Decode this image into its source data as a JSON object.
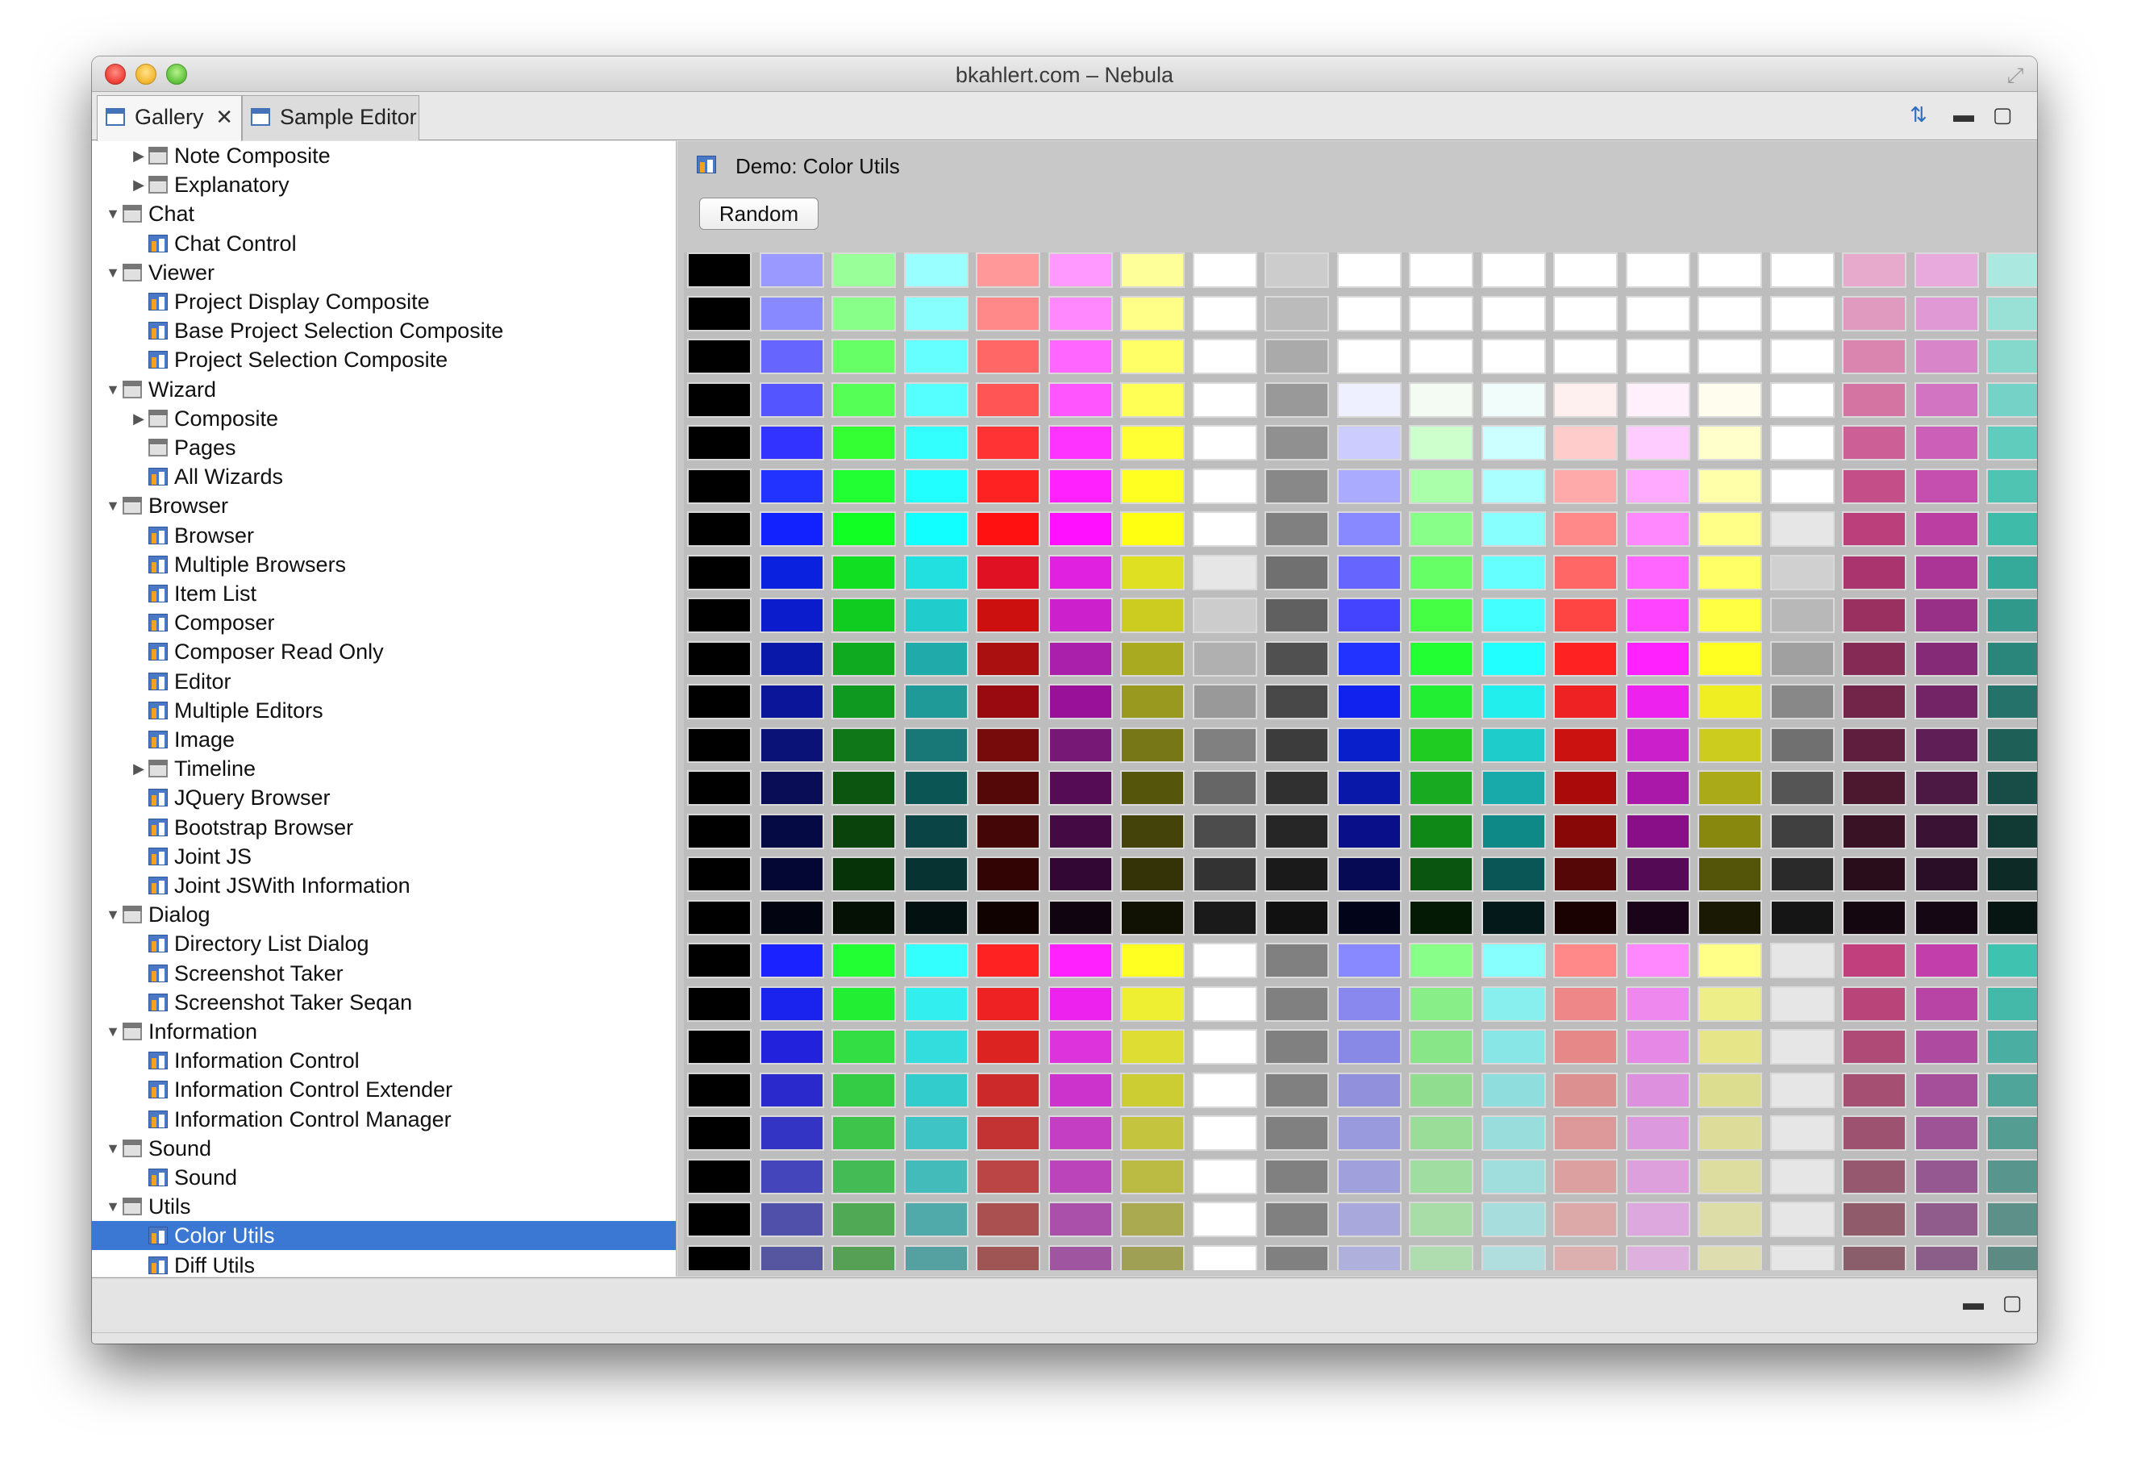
{
  "window": {
    "title": "bkahlert.com – Nebula"
  },
  "tabs": [
    {
      "label": "Gallery",
      "icon": "view-icon",
      "active": true,
      "closable": true
    },
    {
      "label": "Sample Editor",
      "icon": "view-icon",
      "active": false,
      "closable": false
    }
  ],
  "toolbar": {
    "sync_icon": "sync-icon",
    "minimize_icon": "minimize-icon",
    "maximize_icon": "maximize-icon"
  },
  "tree": [
    {
      "label": "Note Composite",
      "depth": 1,
      "twisty": "collapsed",
      "icon": "folder"
    },
    {
      "label": "Explanatory",
      "depth": 1,
      "twisty": "collapsed",
      "icon": "folder"
    },
    {
      "label": "Chat",
      "depth": 0,
      "twisty": "expanded",
      "icon": "folder"
    },
    {
      "label": "Chat Control",
      "depth": 1,
      "twisty": "none",
      "icon": "demo"
    },
    {
      "label": "Viewer",
      "depth": 0,
      "twisty": "expanded",
      "icon": "folder"
    },
    {
      "label": "Project Display Composite",
      "depth": 1,
      "twisty": "none",
      "icon": "demo"
    },
    {
      "label": "Base Project Selection Composite",
      "depth": 1,
      "twisty": "none",
      "icon": "demo"
    },
    {
      "label": "Project Selection Composite",
      "depth": 1,
      "twisty": "none",
      "icon": "demo"
    },
    {
      "label": "Wizard",
      "depth": 0,
      "twisty": "expanded",
      "icon": "folder"
    },
    {
      "label": "Composite",
      "depth": 1,
      "twisty": "collapsed",
      "icon": "folder"
    },
    {
      "label": "Pages",
      "depth": 1,
      "twisty": "none",
      "icon": "folder"
    },
    {
      "label": "All Wizards",
      "depth": 1,
      "twisty": "none",
      "icon": "demo"
    },
    {
      "label": "Browser",
      "depth": 0,
      "twisty": "expanded",
      "icon": "folder"
    },
    {
      "label": "Browser",
      "depth": 1,
      "twisty": "none",
      "icon": "demo"
    },
    {
      "label": "Multiple Browsers",
      "depth": 1,
      "twisty": "none",
      "icon": "demo"
    },
    {
      "label": "Item List",
      "depth": 1,
      "twisty": "none",
      "icon": "demo"
    },
    {
      "label": "Composer",
      "depth": 1,
      "twisty": "none",
      "icon": "demo"
    },
    {
      "label": "Composer Read Only",
      "depth": 1,
      "twisty": "none",
      "icon": "demo"
    },
    {
      "label": "Editor",
      "depth": 1,
      "twisty": "none",
      "icon": "demo"
    },
    {
      "label": "Multiple Editors",
      "depth": 1,
      "twisty": "none",
      "icon": "demo"
    },
    {
      "label": "Image",
      "depth": 1,
      "twisty": "none",
      "icon": "demo"
    },
    {
      "label": "Timeline",
      "depth": 1,
      "twisty": "collapsed",
      "icon": "folder"
    },
    {
      "label": "JQuery Browser",
      "depth": 1,
      "twisty": "none",
      "icon": "demo"
    },
    {
      "label": "Bootstrap Browser",
      "depth": 1,
      "twisty": "none",
      "icon": "demo"
    },
    {
      "label": "Joint JS",
      "depth": 1,
      "twisty": "none",
      "icon": "demo"
    },
    {
      "label": "Joint JSWith Information",
      "depth": 1,
      "twisty": "none",
      "icon": "demo"
    },
    {
      "label": "Dialog",
      "depth": 0,
      "twisty": "expanded",
      "icon": "folder"
    },
    {
      "label": "Directory List Dialog",
      "depth": 1,
      "twisty": "none",
      "icon": "demo"
    },
    {
      "label": "Screenshot Taker",
      "depth": 1,
      "twisty": "none",
      "icon": "demo"
    },
    {
      "label": "Screenshot Taker Seqan",
      "depth": 1,
      "twisty": "none",
      "icon": "demo"
    },
    {
      "label": "Information",
      "depth": 0,
      "twisty": "expanded",
      "icon": "folder"
    },
    {
      "label": "Information Control",
      "depth": 1,
      "twisty": "none",
      "icon": "demo"
    },
    {
      "label": "Information Control Extender",
      "depth": 1,
      "twisty": "none",
      "icon": "demo"
    },
    {
      "label": "Information Control Manager",
      "depth": 1,
      "twisty": "none",
      "icon": "demo"
    },
    {
      "label": "Sound",
      "depth": 0,
      "twisty": "expanded",
      "icon": "folder"
    },
    {
      "label": "Sound",
      "depth": 1,
      "twisty": "none",
      "icon": "demo"
    },
    {
      "label": "Utils",
      "depth": 0,
      "twisty": "expanded",
      "icon": "folder"
    },
    {
      "label": "Color Utils",
      "depth": 1,
      "twisty": "none",
      "icon": "demo",
      "selected": true
    },
    {
      "label": "Diff Utils",
      "depth": 1,
      "twisty": "none",
      "icon": "demo"
    }
  ],
  "demo": {
    "title": "Demo: Color Utils",
    "random_label": "Random"
  },
  "palette": {
    "rows_opaque": [
      [
        "#000000",
        "#9999ff",
        "#99ff99",
        "#99ffff",
        "#ff9999",
        "#ff99ff",
        "#ffff99",
        "#ffffff",
        "#cccccc",
        "#ffffff",
        "#ffffff",
        "#ffffff",
        "#ffffff",
        "#ffffff",
        "#ffffff",
        "#ffffff",
        "#e8aacc",
        "#e8aadd",
        "#aae8e0"
      ],
      [
        "#000000",
        "#8888ff",
        "#88ff88",
        "#88ffff",
        "#ff8888",
        "#ff88ff",
        "#ffff88",
        "#ffffff",
        "#bbbbbb",
        "#ffffff",
        "#ffffff",
        "#ffffff",
        "#ffffff",
        "#ffffff",
        "#ffffff",
        "#ffffff",
        "#e099bf",
        "#e099d4",
        "#99e0d6"
      ],
      [
        "#000000",
        "#6666ff",
        "#66ff66",
        "#66ffff",
        "#ff6666",
        "#ff66ff",
        "#ffff66",
        "#ffffff",
        "#aaaaaa",
        "#ffffff",
        "#ffffff",
        "#ffffff",
        "#ffffff",
        "#ffffff",
        "#ffffff",
        "#ffffff",
        "#d985b0",
        "#d985c9",
        "#85d9cc"
      ],
      [
        "#000000",
        "#5555ff",
        "#55ff55",
        "#55ffff",
        "#ff5555",
        "#ff55ff",
        "#ffff55",
        "#ffffff",
        "#999999",
        "#eef0ff",
        "#f3fbf3",
        "#f0fdfb",
        "#fff0f0",
        "#fff0fb",
        "#fffdee",
        "#ffffff",
        "#d374a3",
        "#d374c2",
        "#74d3c6"
      ],
      [
        "#000000",
        "#3333ff",
        "#33ff33",
        "#33ffff",
        "#ff3333",
        "#ff33ff",
        "#ffff33",
        "#ffffff",
        "#909090",
        "#ccccff",
        "#ccffcc",
        "#ccffff",
        "#ffcccc",
        "#ffccff",
        "#ffffcc",
        "#ffffff",
        "#cc5f96",
        "#cc5fb8",
        "#5fccbd"
      ],
      [
        "#000000",
        "#2233ff",
        "#22ff33",
        "#22ffff",
        "#ff2222",
        "#ff22ff",
        "#ffff22",
        "#ffffff",
        "#888888",
        "#aaaaff",
        "#aaffaa",
        "#aaffff",
        "#ffaaaa",
        "#ffaaff",
        "#ffffaa",
        "#ffffff",
        "#c44f88",
        "#c44fae",
        "#4fc4b3"
      ],
      [
        "#000000",
        "#1122ff",
        "#11ff22",
        "#11ffff",
        "#ff1111",
        "#ff11ff",
        "#ffff11",
        "#ffffff",
        "#808080",
        "#8888ff",
        "#88ff88",
        "#88ffff",
        "#ff8888",
        "#ff88ff",
        "#ffff88",
        "#e6e6e6",
        "#bb3f7b",
        "#bb3fa3",
        "#3fbba9"
      ],
      [
        "#000000",
        "#0a22e0",
        "#11e022",
        "#22e0e0",
        "#e01122",
        "#e022e0",
        "#e0e022",
        "#e6e6e6",
        "#707070",
        "#6666ff",
        "#66ff66",
        "#66ffff",
        "#ff6666",
        "#ff66ff",
        "#ffff66",
        "#d0d0d0",
        "#aa356e",
        "#aa3596",
        "#35aa9b"
      ],
      [
        "#000000",
        "#0a1ccc",
        "#10cc20",
        "#20cccc",
        "#cc1010",
        "#cc20cc",
        "#cccc20",
        "#cccccc",
        "#606060",
        "#4444ff",
        "#44ff44",
        "#44ffff",
        "#ff4444",
        "#ff44ff",
        "#ffff44",
        "#b8b8b8",
        "#993060",
        "#993088",
        "#30998c"
      ],
      [
        "#000000",
        "#0a18aa",
        "#10aa20",
        "#20aaaa",
        "#aa1010",
        "#aa20aa",
        "#aaaa20",
        "#b0b0b0",
        "#505050",
        "#2233ff",
        "#22ff33",
        "#22ffff",
        "#ff2222",
        "#ff22ff",
        "#ffff22",
        "#a0a0a0",
        "#852a54",
        "#852a77",
        "#2a857a"
      ],
      [
        "#000000",
        "#0a1599",
        "#109920",
        "#209999",
        "#990a10",
        "#991099",
        "#999920",
        "#999999",
        "#484848",
        "#1122ee",
        "#22ee33",
        "#22eeee",
        "#ee2222",
        "#ee22ee",
        "#eeee22",
        "#888888",
        "#722449",
        "#722466",
        "#247269"
      ],
      [
        "#000000",
        "#0a1177",
        "#107718",
        "#187777",
        "#770a0a",
        "#771877",
        "#777718",
        "#808080",
        "#3c3c3c",
        "#0a1fcc",
        "#1fcc22",
        "#1fcccc",
        "#cc1111",
        "#cc1fcc",
        "#cccc1f",
        "#707070",
        "#5f1e3d",
        "#5f1e55",
        "#1e5f57"
      ],
      [
        "#000000",
        "#080d55",
        "#0c5510",
        "#0c5555",
        "#550808",
        "#550c55",
        "#55550c",
        "#666666",
        "#303030",
        "#0a18aa",
        "#18aa20",
        "#18aaaa",
        "#aa0a0a",
        "#aa18aa",
        "#aaaa18",
        "#555555",
        "#4c1830",
        "#4c1844",
        "#184c46"
      ],
      [
        "#000000",
        "#060a44",
        "#0a440c",
        "#0a4444",
        "#440606",
        "#440a44",
        "#44440a",
        "#4c4c4c",
        "#262626",
        "#080f88",
        "#0f8818",
        "#0f8888",
        "#880808",
        "#880f88",
        "#88880f",
        "#404040",
        "#3a1225",
        "#3a1234",
        "#123a35"
      ],
      [
        "#000000",
        "#040733",
        "#073308",
        "#073333",
        "#330404",
        "#330733",
        "#333307",
        "#333333",
        "#1a1a1a",
        "#060a55",
        "#0a5510",
        "#0a5555",
        "#550606",
        "#550a55",
        "#55550a",
        "#2a2a2a",
        "#2a0d1b",
        "#2a0d26",
        "#0d2a27"
      ],
      [
        "#000000",
        "#020411",
        "#041104",
        "#041111",
        "#110202",
        "#110411",
        "#111104",
        "#1a1a1a",
        "#111111",
        "#02041a",
        "#041a04",
        "#041a1a",
        "#1a0202",
        "#1a041a",
        "#1a1a04",
        "#151515",
        "#150710",
        "#150713",
        "#071513"
      ],
      [
        "#000000",
        "#1a22ff",
        "#22ff33",
        "#33ffff",
        "#ff2222",
        "#ff22ff",
        "#ffff22",
        "#ffffff",
        "#808080",
        "#8888ff",
        "#88ff88",
        "#88ffff",
        "#ff8888",
        "#ff88ff",
        "#ffff88",
        "#e6e6e6",
        "#c23f7e",
        "#c23fab",
        "#3fc2b0"
      ],
      [
        "#000000",
        "#1a22ee",
        "#22ee33",
        "#33eeee",
        "#ee2222",
        "#ee22ee",
        "#eeee33",
        "#ffffff",
        "#808080",
        "#8888ee",
        "#88ee88",
        "#88eeee",
        "#ee8888",
        "#ee88ee",
        "#eeee88",
        "#e6e6e6",
        "#b84479",
        "#b844a6",
        "#44b8a9"
      ],
      [
        "#000000",
        "#2222dd",
        "#33dd44",
        "#33dddd",
        "#dd2222",
        "#dd33dd",
        "#dddd33",
        "#ffffff",
        "#808080",
        "#8888e6",
        "#88e688",
        "#88e6e6",
        "#e68888",
        "#e688e6",
        "#e6e688",
        "#e6e6e6",
        "#ae4a75",
        "#ae4aa0",
        "#4aaea2"
      ],
      [
        "#000000",
        "#2a2acc",
        "#33cc44",
        "#33cccc",
        "#cc2a2a",
        "#cc33cc",
        "#cccc33",
        "#ffffff",
        "#808080",
        "#9090dd",
        "#90dd90",
        "#90dddd",
        "#dd9090",
        "#dd90dd",
        "#dddd90",
        "#e6e6e6",
        "#a54f72",
        "#a54f9b",
        "#4fa59a"
      ],
      [
        "#000000",
        "#3333c4",
        "#3ec44a",
        "#3ec4c4",
        "#c43333",
        "#c43ec4",
        "#c4c43e",
        "#ffffff",
        "#808080",
        "#9999dd",
        "#99dd99",
        "#99dddd",
        "#dd9999",
        "#dd99dd",
        "#dddd99",
        "#e6e6e6",
        "#9d5370",
        "#9d5395",
        "#539d93"
      ],
      [
        "#000000",
        "#4444bb",
        "#44bb55",
        "#44bbbb",
        "#bb4444",
        "#bb44bb",
        "#bbbb44",
        "#ffffff",
        "#808080",
        "#a0a0dd",
        "#a0dda0",
        "#a0dddd",
        "#dda0a0",
        "#dda0dd",
        "#dddda0",
        "#e6e6e6",
        "#95586e",
        "#955890",
        "#58958d"
      ],
      [
        "#000000",
        "#5050aa",
        "#50aa55",
        "#50aaaa",
        "#aa5050",
        "#aa50aa",
        "#aaaa50",
        "#ffffff",
        "#808080",
        "#a8a8dd",
        "#a8dda8",
        "#a8dddd",
        "#dda8a8",
        "#dda8dd",
        "#dddda8",
        "#e6e6e6",
        "#905c6c",
        "#905c8c",
        "#5c9088"
      ],
      [
        "#000000",
        "#5555a0",
        "#55a055",
        "#55a0a0",
        "#a05555",
        "#a055a0",
        "#a0a055",
        "#ffffff",
        "#808080",
        "#b0b0dd",
        "#b0ddb0",
        "#b0dddd",
        "#ddb0b0",
        "#ddb0dd",
        "#ddddb0",
        "#e6e6e6",
        "#8a5e6a",
        "#8a5e88",
        "#5e8a84"
      ]
    ]
  }
}
